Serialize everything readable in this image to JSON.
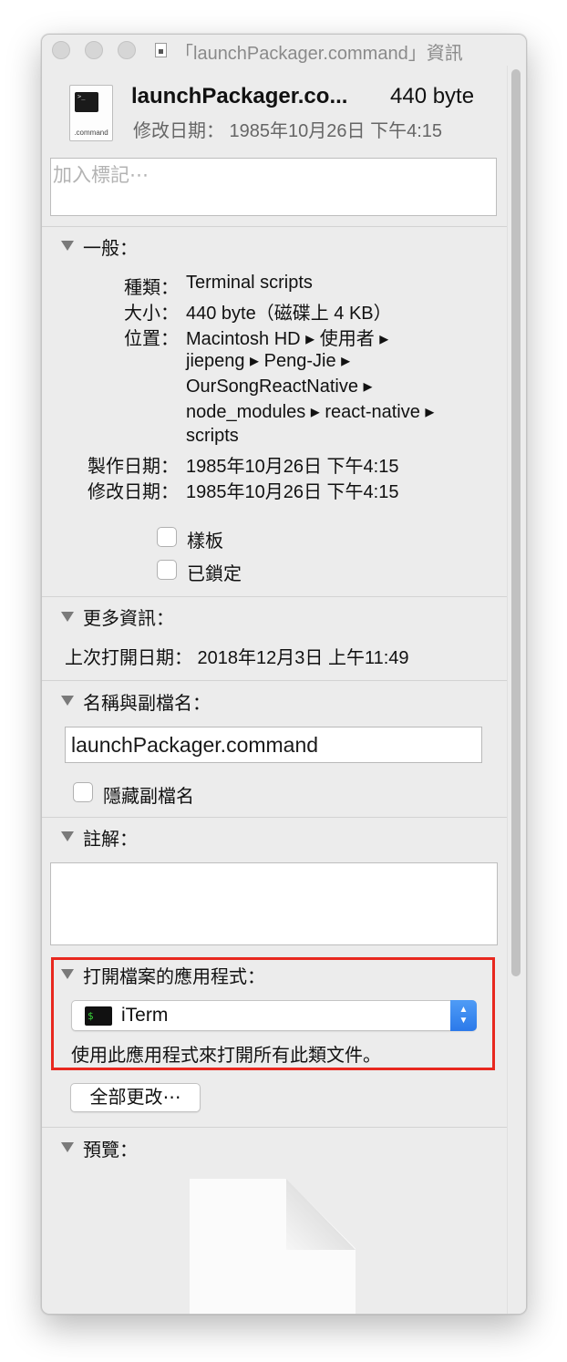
{
  "window": {
    "title": "「launchPackager.command」資訊"
  },
  "header": {
    "icon_ext": ".command",
    "icon_term_glyph": ">_",
    "name": "launchPackager.co...",
    "size": "440 byte",
    "modified": "修改日期： 1985年10月26日 下午4:15"
  },
  "tags": {
    "placeholder": "加入標記⋯"
  },
  "general": {
    "title": "一般：",
    "kind_label": "種類：",
    "kind_value": "Terminal scripts",
    "size_label": "大小：",
    "size_value": "440 byte（磁碟上 4 KB）",
    "where_label": "位置：",
    "where_lines": [
      "Macintosh HD ▸ 使用者 ▸",
      "jiepeng ▸ Peng-Jie ▸",
      "OurSongReactNative ▸",
      "node_modules ▸ react-native ▸",
      "scripts"
    ],
    "created_label": "製作日期：",
    "created_value": "1985年10月26日 下午4:15",
    "modified_label": "修改日期：",
    "modified_value": "1985年10月26日 下午4:15",
    "stationery_label": "樣板",
    "locked_label": "已鎖定"
  },
  "more_info": {
    "title": "更多資訊：",
    "last_opened": "上次打開日期： 2018年12月3日 上午11:49"
  },
  "name_ext": {
    "title": "名稱與副檔名：",
    "value": "launchPackager.command",
    "hide_ext_label": "隱藏副檔名"
  },
  "comments": {
    "title": "註解："
  },
  "open_with": {
    "title": "打開檔案的應用程式：",
    "app": "iTerm",
    "app_icon_glyph": "$ ",
    "description": "使用此應用程式來打開所有此類文件。",
    "change_all_label": "全部更改⋯"
  },
  "preview": {
    "title": "預覽："
  },
  "colors": {
    "highlight": "#e8281f",
    "accent": "#2b79ea"
  }
}
